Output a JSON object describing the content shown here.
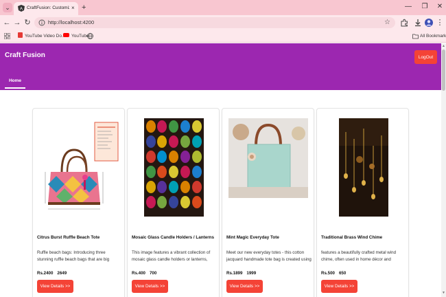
{
  "browser": {
    "tab": {
      "title": "CraftFusion: Customize By you",
      "close": "×"
    },
    "new_tab": "+",
    "address": {
      "url": "http://localhost:4200"
    },
    "window": {
      "minimize": "—",
      "restore": "❐",
      "close": "✕"
    },
    "bookmarks": [
      {
        "label": "YouTube Video Do..."
      },
      {
        "label": "YouTube"
      }
    ],
    "all_bookmarks": "All Bookmarks"
  },
  "app": {
    "title": "Craft Fusion",
    "logout_label": "LogOut",
    "nav_home": "Home",
    "view_details_label": "View Details >>",
    "accent_color": "#9c27b0",
    "button_color": "#f44336"
  },
  "products": [
    {
      "name": "Citrus Burst Ruffle Beach Tote",
      "description": "Ruffle beach bags: Introducing three stunning ruffle beach bags that are big enough to carry",
      "price": "Rs.2400",
      "original_price": "2649"
    },
    {
      "name": "Mosaic Glass Candle Holders / Lanterns",
      "description": "This image features a vibrant collection of mosaic glass candle holders or lanterns,",
      "price": "Rs.400",
      "original_price": "700"
    },
    {
      "name": "Mint Magic Everyday Tote",
      "description": "Meet our new everyday totes - this cotton jacquard handmade tote bag is created using",
      "price": "Rs.1899",
      "original_price": "1999"
    },
    {
      "name": "Traditional Brass Wind Chime",
      "description": "features a beautifully crafted metal wind chime, often used in home décor and",
      "price": "Rs.500",
      "original_price": "650"
    }
  ]
}
